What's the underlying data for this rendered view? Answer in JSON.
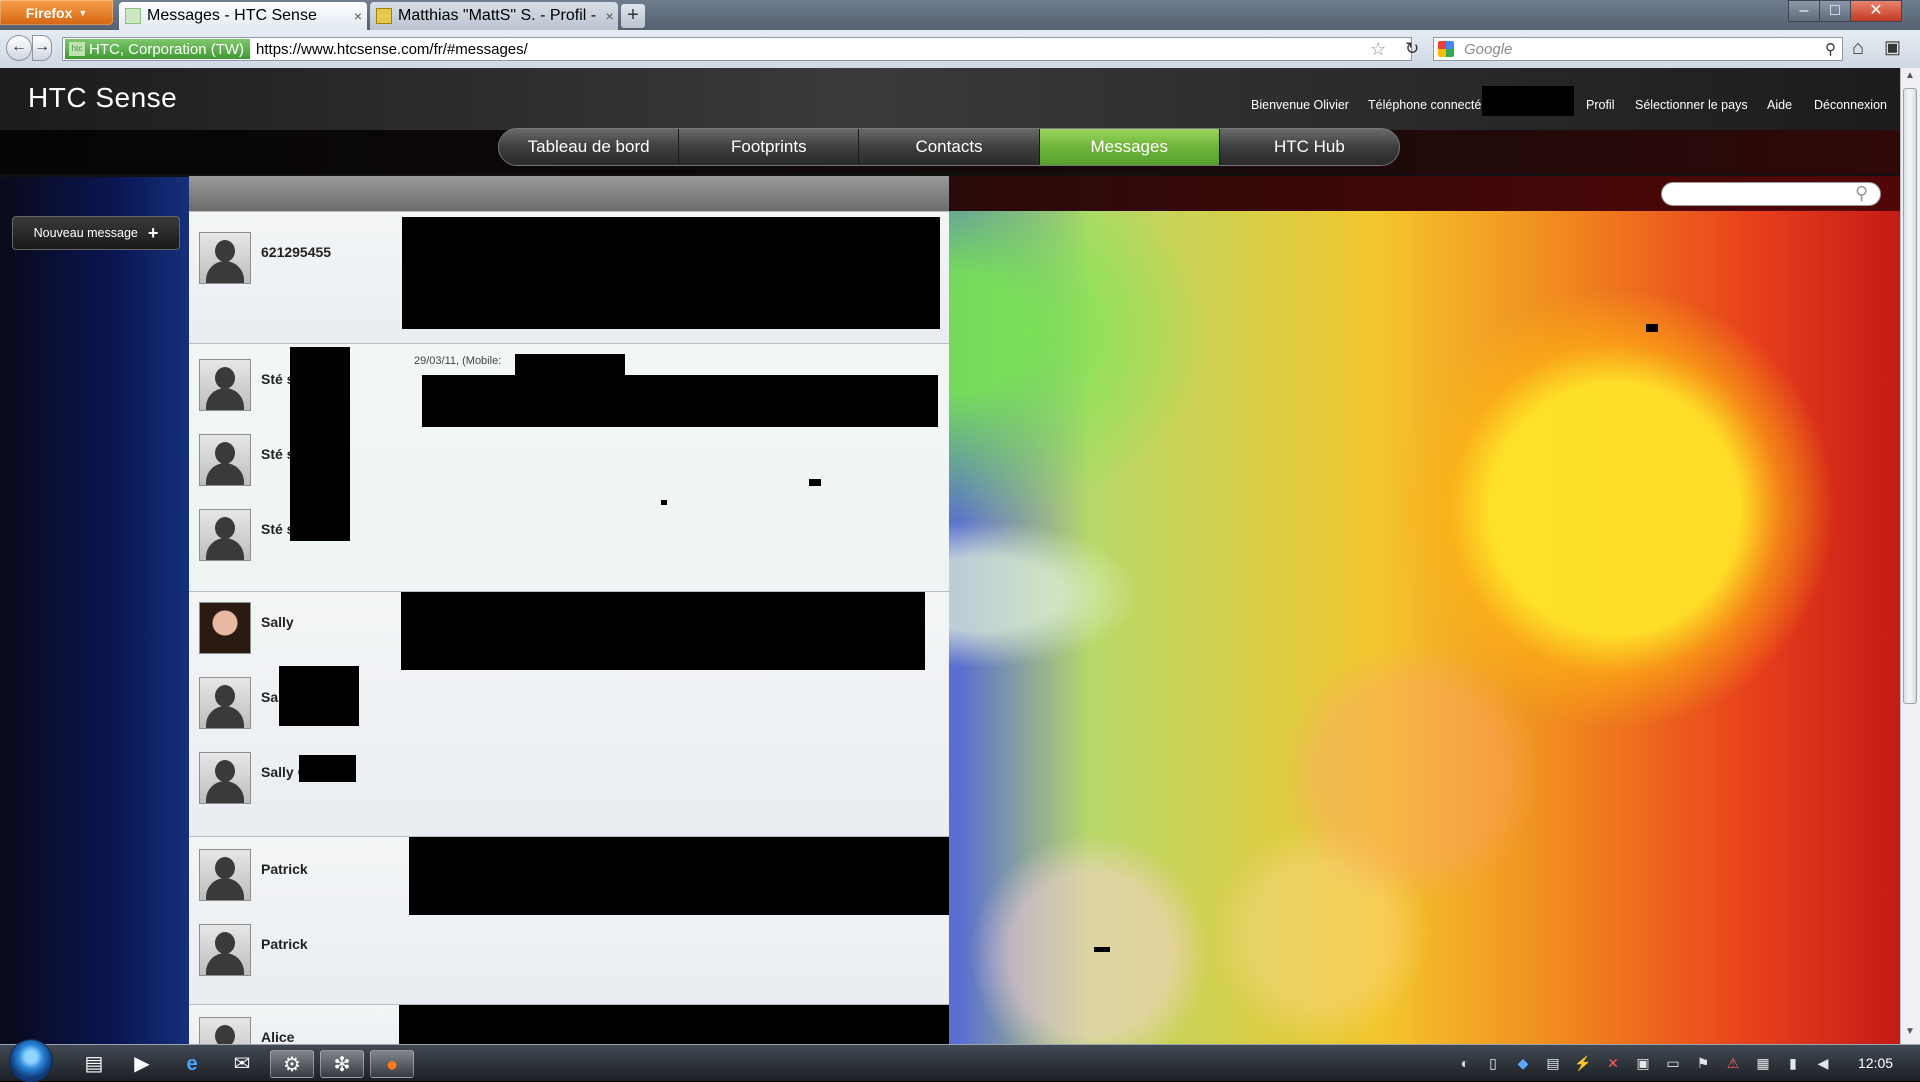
{
  "browser": {
    "app_button": "Firefox",
    "tabs": [
      {
        "title": "Messages - HTC Sense",
        "active": true
      },
      {
        "title": "Matthias \"MattS\" S. - Profil - ..."
      }
    ],
    "identity": "HTC, Corporation (TW)",
    "url": "https://www.htcsense.com/fr/#messages/",
    "search_placeholder": "Google",
    "icons": {
      "back": "←",
      "forward": "→",
      "star": "☆",
      "reload": "↻",
      "home": "⌂",
      "addon": "▣",
      "newtab": "+",
      "close": "×",
      "minimize": "‒",
      "maximize": "□",
      "winclose": "✕",
      "search": "⚲"
    }
  },
  "site": {
    "logo": "HTC Sense",
    "top_links": {
      "welcome": "Bienvenue Olivier",
      "phone": "Téléphone connecté",
      "profile": "Profil",
      "country": "Sélectionner le pays",
      "help": "Aide",
      "logout": "Déconnexion"
    },
    "nav_tabs": [
      {
        "label": "Tableau de bord"
      },
      {
        "label": "Footprints"
      },
      {
        "label": "Contacts"
      },
      {
        "label": "Messages",
        "active": true
      },
      {
        "label": "HTC Hub"
      }
    ],
    "new_message": "Nouveau message",
    "new_message_icon": "+",
    "search_icon": "⚲"
  },
  "messages": {
    "threads": [
      {
        "contact": "621295455"
      },
      {
        "contact": "Sté s",
        "date": "29/03/11, (Mobile:"
      },
      {
        "contact": "Sté s"
      },
      {
        "contact": "Sté s"
      },
      {
        "contact": "Sally"
      },
      {
        "contact": "Sal"
      },
      {
        "contact": "Sally C"
      },
      {
        "contact": "Patrick"
      },
      {
        "contact": "Patrick"
      },
      {
        "contact": "Alice"
      }
    ]
  },
  "taskbar": {
    "clock": "12:05",
    "icons": [
      "▤",
      "▶",
      "e",
      "✉",
      "⚙",
      "❇",
      "●"
    ]
  },
  "colors": {
    "active_tab": "#6fb43a",
    "brand_orange": "#d66511"
  }
}
